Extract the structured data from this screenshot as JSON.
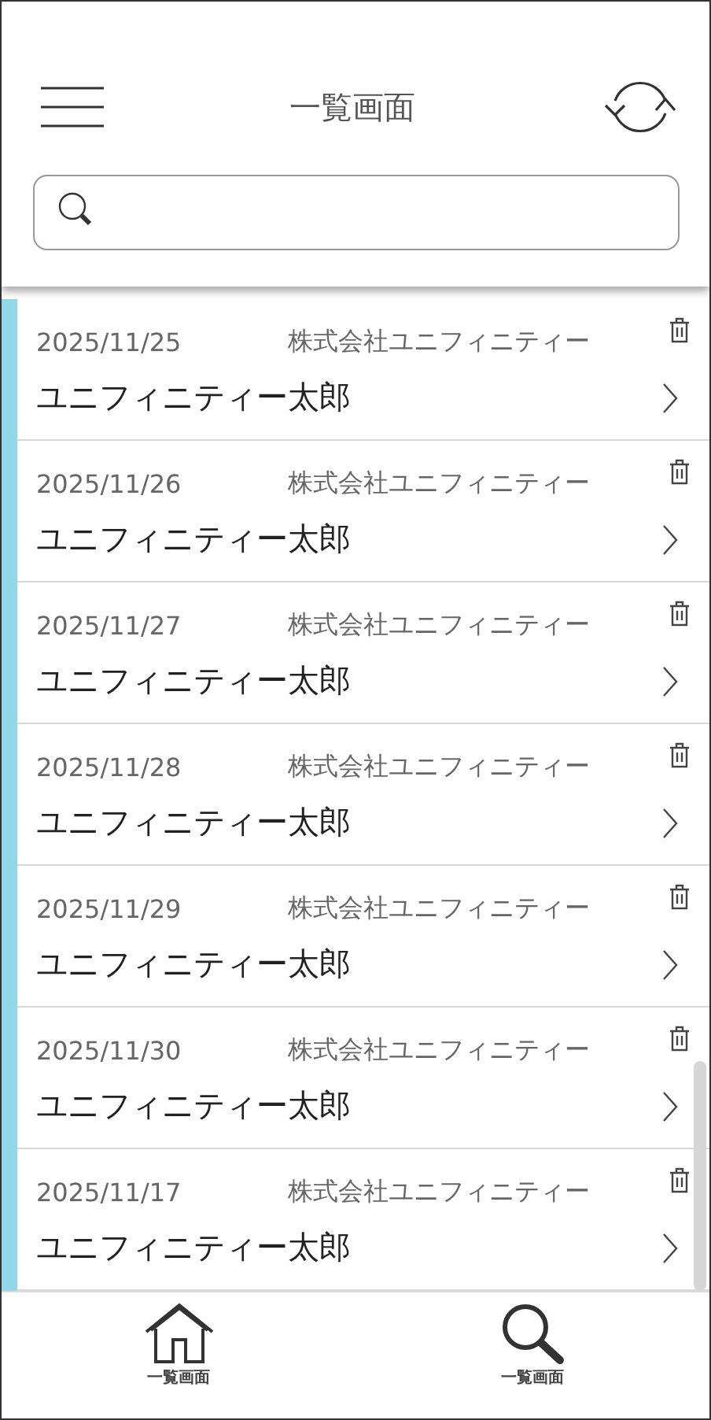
{
  "header": {
    "title": "一覧画面"
  },
  "records": [
    {
      "date": "2025/11/25",
      "company": "株式会社ユニフィニティー",
      "name": "ユニフィニティー太郎"
    },
    {
      "date": "2025/11/26",
      "company": "株式会社ユニフィニティー",
      "name": "ユニフィニティー太郎"
    },
    {
      "date": "2025/11/27",
      "company": "株式会社ユニフィニティー",
      "name": "ユニフィニティー太郎"
    },
    {
      "date": "2025/11/28",
      "company": "株式会社ユニフィニティー",
      "name": "ユニフィニティー太郎"
    },
    {
      "date": "2025/11/29",
      "company": "株式会社ユニフィニティー",
      "name": "ユニフィニティー太郎"
    },
    {
      "date": "2025/11/30",
      "company": "株式会社ユニフィニティー",
      "name": "ユニフィニティー太郎"
    },
    {
      "date": "2025/11/17",
      "company": "株式会社ユニフィニティー",
      "name": "ユニフィニティー太郎"
    }
  ],
  "bottom_nav": [
    {
      "kind": "home",
      "label": "一覧画面"
    },
    {
      "kind": "search",
      "label": "一覧画面"
    }
  ]
}
